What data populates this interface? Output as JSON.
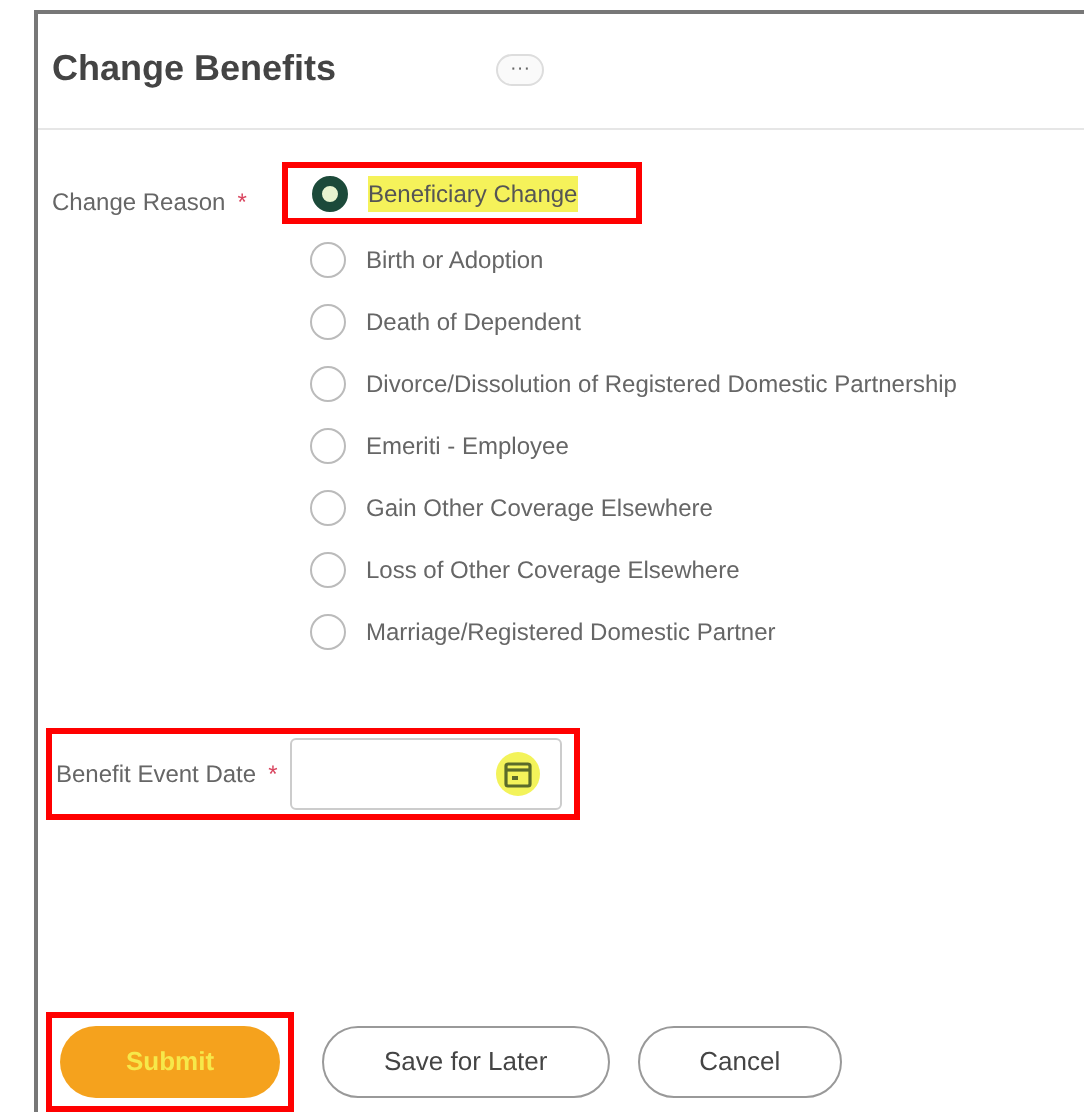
{
  "title": "Change Benefits",
  "more_button": "···",
  "change_reason": {
    "label": "Change Reason",
    "required_mark": "*",
    "options": [
      {
        "label": "Beneficiary Change",
        "selected": true,
        "annotated": true
      },
      {
        "label": "Birth or Adoption",
        "selected": false,
        "annotated": false
      },
      {
        "label": "Death of Dependent",
        "selected": false,
        "annotated": false
      },
      {
        "label": "Divorce/Dissolution of Registered Domestic Partnership",
        "selected": false,
        "annotated": false
      },
      {
        "label": "Emeriti - Employee",
        "selected": false,
        "annotated": false
      },
      {
        "label": "Gain Other Coverage Elsewhere",
        "selected": false,
        "annotated": false
      },
      {
        "label": "Loss of Other Coverage Elsewhere",
        "selected": false,
        "annotated": false
      },
      {
        "label": "Marriage/Registered Domestic Partner",
        "selected": false,
        "annotated": false
      }
    ]
  },
  "event_date": {
    "label": "Benefit Event Date",
    "required_mark": "*",
    "annotated": true
  },
  "buttons": [
    {
      "label": "Submit",
      "kind": "primary",
      "annotated": true
    },
    {
      "label": "Save for Later",
      "kind": "secondary",
      "annotated": false
    },
    {
      "label": "Cancel",
      "kind": "secondary",
      "annotated": false
    }
  ]
}
